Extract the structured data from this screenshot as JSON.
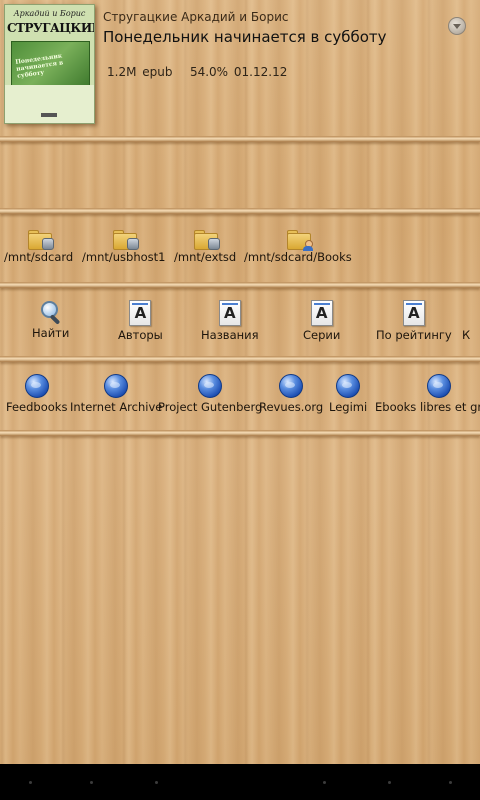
{
  "recent_book": {
    "cover": {
      "author_line": "Аркадий и Борис",
      "title_line": "СТРУГАЦКИЕ",
      "art_text": "Понедельник начинается в субботу"
    },
    "author": "Стругацкие Аркадий и Борис",
    "title": "Понедельник начинается в субботу",
    "size": "1.2M",
    "format": "epub",
    "progress": "54.0%",
    "date": "01.12.12"
  },
  "folders": [
    {
      "label": "/mnt/sdcard",
      "icon": "folder-sdcard-icon"
    },
    {
      "label": "/mnt/usbhost1",
      "icon": "folder-usb-icon"
    },
    {
      "label": "/mnt/extsd",
      "icon": "folder-extsd-icon"
    },
    {
      "label": "/mnt/sdcard/Books",
      "icon": "folder-books-icon"
    }
  ],
  "library": [
    {
      "label": "Найти",
      "icon": "search-icon"
    },
    {
      "label": "Авторы",
      "icon": "authors-icon",
      "glyph": "A"
    },
    {
      "label": "Названия",
      "icon": "titles-icon",
      "glyph": "A"
    },
    {
      "label": "Серии",
      "icon": "series-icon",
      "glyph": "A"
    },
    {
      "label": "По рейтингу",
      "icon": "rating-icon",
      "glyph": "A"
    },
    {
      "label": "К",
      "icon": ""
    }
  ],
  "online_catalogs": [
    {
      "label": "Feedbooks",
      "icon": "globe-icon"
    },
    {
      "label": "Internet Archive",
      "icon": "globe-icon"
    },
    {
      "label": "Project Gutenberg",
      "icon": "globe-icon"
    },
    {
      "label": "Revues.org",
      "icon": "globe-icon"
    },
    {
      "label": "Legimi",
      "icon": "globe-icon"
    },
    {
      "label": "Ebooks libres et gr",
      "icon": "globe-icon"
    }
  ],
  "colors": {
    "wood": "#d8b07e",
    "text": "#1d150c",
    "navbar": "#000000"
  }
}
